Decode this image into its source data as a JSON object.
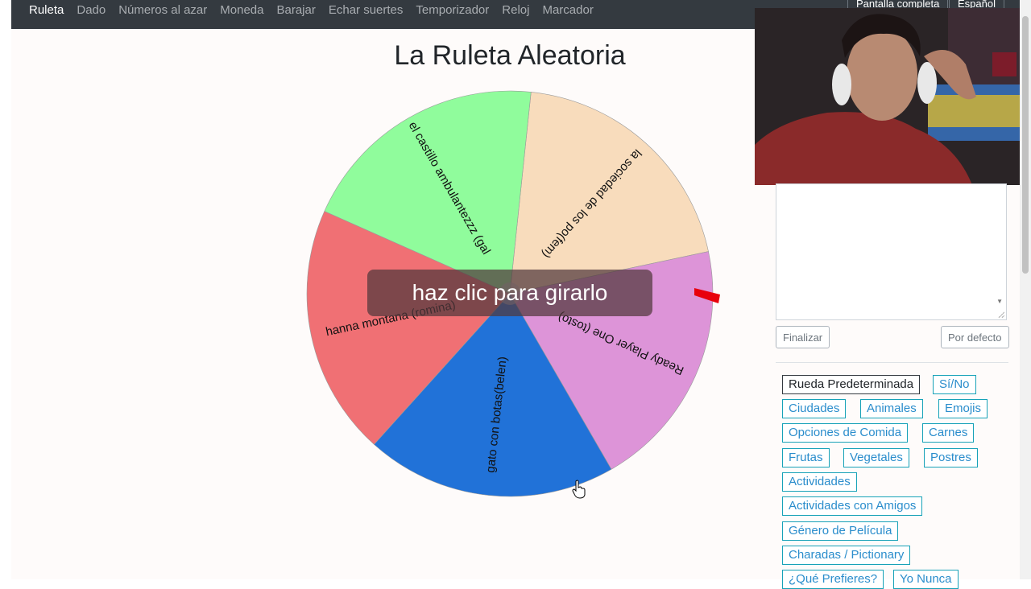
{
  "nav": {
    "links": [
      "Ruleta",
      "Dado",
      "Números al azar",
      "Moneda",
      "Barajar",
      "Echar suertes",
      "Temporizador",
      "Reloj",
      "Marcador"
    ],
    "button_fullscreen": "Pantalla completa",
    "button_language": "Español"
  },
  "page": {
    "title": "La Ruleta Aleatoria",
    "spin_hint": "haz clic para girarlo"
  },
  "wheel": {
    "segments": [
      {
        "label": "la sociedad de los po(fem)",
        "color": "#f8dcbc"
      },
      {
        "label": "Ready Player One (tosto)",
        "color": "#dd94d8"
      },
      {
        "label": "gato con botas(belen)",
        "color": "#2172d8"
      },
      {
        "label": "hanna montana (romina)",
        "color": "#f07074"
      },
      {
        "label": "el castillo ambulantezzz (gal",
        "color": "#90fc9c"
      }
    ],
    "pointer_color": "#e8000c"
  },
  "editor": {
    "textarea_value": "",
    "finish_button": "Finalizar",
    "default_button": "Por defecto"
  },
  "presets": {
    "items": [
      "Rueda Predeterminada",
      "Sí/No",
      "Ciudades",
      "Animales",
      "Emojis",
      "Opciones de Comida",
      "Carnes",
      "Frutas",
      "Vegetales",
      "Postres",
      "Actividades",
      "Actividades con Amigos",
      "Género de Película",
      "Charadas / Pictionary",
      "¿Qué Prefieres?",
      "Yo Nunca"
    ]
  },
  "colors": {
    "navbar": "#343a40",
    "link_accent": "#2a8dcc"
  }
}
